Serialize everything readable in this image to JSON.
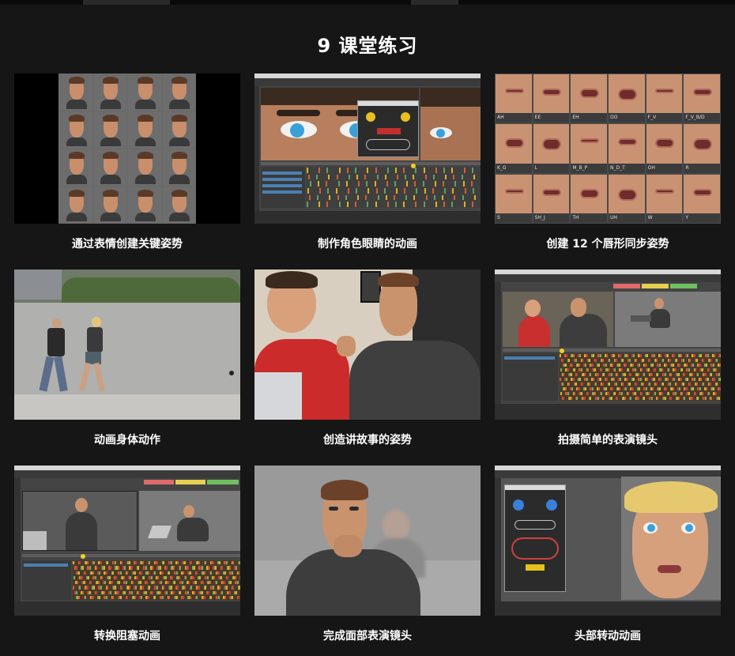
{
  "page": {
    "title": "9 课堂练习"
  },
  "cards": [
    {
      "caption": "通过表情创建关键姿势",
      "thumb_icon": "expression-sheet-thumbnail"
    },
    {
      "caption": "制作角色眼睛的动画",
      "thumb_icon": "eye-animation-thumbnail"
    },
    {
      "caption": "创建 12 个唇形同步姿势",
      "thumb_icon": "lip-sync-thumbnail"
    },
    {
      "caption": "动画身体动作",
      "thumb_icon": "walk-reference-thumbnail"
    },
    {
      "caption": "创造讲故事的姿势",
      "thumb_icon": "storytelling-pose-thumbnail"
    },
    {
      "caption": "拍摄简单的表演镜头",
      "thumb_icon": "acting-shot-thumbnail"
    },
    {
      "caption": "转换阻塞动画",
      "thumb_icon": "blocking-conversion-thumbnail"
    },
    {
      "caption": "完成面部表演镜头",
      "thumb_icon": "facial-performance-thumbnail"
    },
    {
      "caption": "头部转动动画",
      "thumb_icon": "head-turn-thumbnail"
    }
  ],
  "lip_labels": [
    "AH",
    "EE",
    "EH",
    "OO",
    "F_V",
    "F_V_B/D",
    "K_G",
    "L",
    "M_B_P",
    "N_D_T",
    "OH",
    "R",
    "S",
    "SH_J",
    "TH",
    "UH",
    "W",
    "Y"
  ],
  "colors": {
    "background": "#161616",
    "text": "#ffffff",
    "maya_panel": "#444444",
    "maya_timeline_key": "#e0b020"
  }
}
